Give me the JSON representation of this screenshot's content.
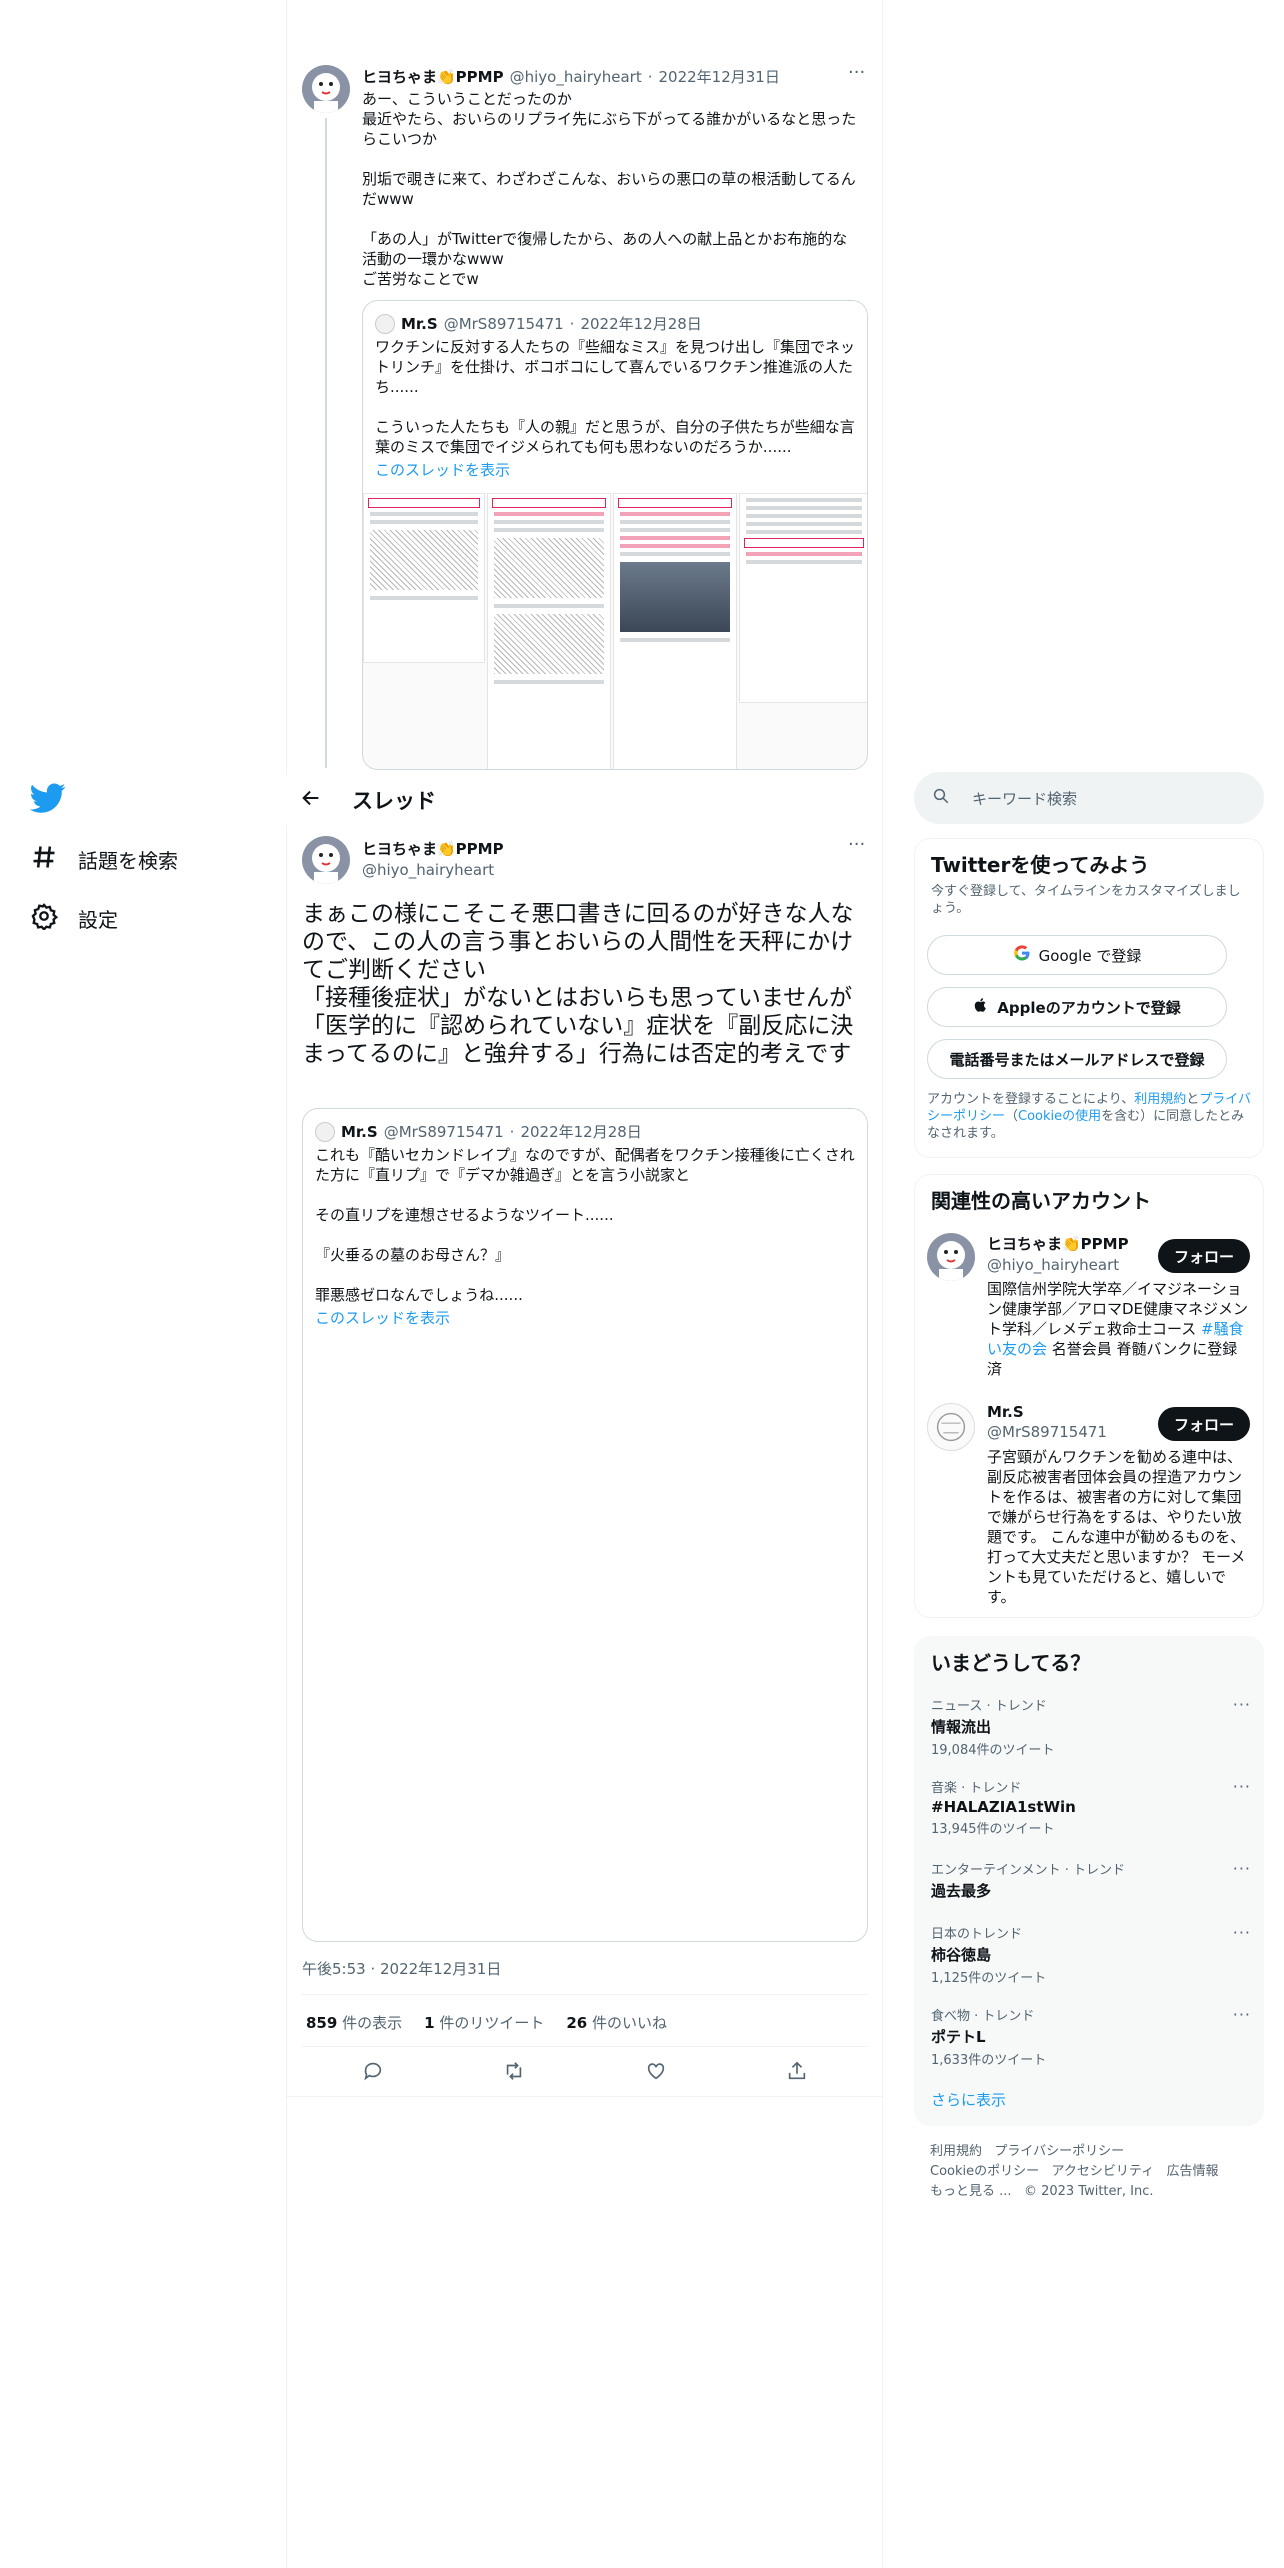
{
  "nav": {
    "explore_label": "話題を検索",
    "settings_label": "設定"
  },
  "prev_tweet": {
    "name": "ヒヨちゃま👏PPMP",
    "handle": "@hiyo_hairyheart",
    "date": "2022年12月31日",
    "more": "···",
    "text": "あー、こういうことだったのか\n最近やたら、おいらのリプライ先にぶら下がってる誰かがいるなと思ったらこいつか\n\n別垢で覗きに来て、わざわざこんな、おいらの悪口の草の根活動してるんだwww\n\n「あの人」がTwitterで復帰したから、あの人への献上品とかお布施的な活動の一環かなwww\nご苦労なことでw",
    "quote": {
      "name": "Mr.S",
      "handle": "@MrS89715471",
      "date": "2022年12月28日",
      "text": "ワクチンに反対する人たちの『些細なミス』を見つけ出し『集団でネットリンチ』を仕掛け、ボコボコにして喜んでいるワクチン推進派の人たち......\n\nこういった人たちも『人の親』だと思うが、自分の子供たちが些細な言葉のミスで集団でイジメられても何も思わないのだろうか......",
      "show_thread": "このスレッドを表示"
    }
  },
  "header": {
    "title": "スレッド"
  },
  "main_tweet": {
    "name": "ヒヨちゃま👏PPMP",
    "handle": "@hiyo_hairyheart",
    "more": "···",
    "text": "まぁこの様にこそこそ悪口書きに回るのが好きな人なので、この人の言う事とおいらの人間性を天秤にかけてご判断ください\n「接種後症状」がないとはおいらも思っていませんが「医学的に『認められていない』症状を『副反応に決まってるのに』と強弁する」行為には否定的考えです",
    "quote": {
      "name": "Mr.S",
      "handle": "@MrS89715471",
      "date": "2022年12月28日",
      "text": "これも『酷いセカンドレイプ』なのですが、配偶者をワクチン接種後に亡くされた方に『直リプ』で『デマか雑過ぎ』とを言う小説家と\n\nその直リプを連想させるようなツイート......\n\n『火垂るの墓のお母さん？』\n\n罪悪感ゼロなんでしょうね......",
      "show_thread": "このスレッドを表示"
    },
    "timestamp": "午後5:53 · 2022年12月31日",
    "stats": {
      "views_num": "859",
      "views_label": "件の表示",
      "retweets_num": "1",
      "retweets_label": "件のリツイート",
      "likes_num": "26",
      "likes_label": "件のいいね"
    }
  },
  "sidebar": {
    "search_placeholder": "キーワード検索",
    "signup": {
      "title": "Twitterを使ってみよう",
      "subtitle": "今すぐ登録して、タイムラインをカスタマイズしましょう。",
      "google": "Google で登録",
      "apple": "Appleのアカウントで登録",
      "phone": "電話番号またはメールアドレスで登録",
      "terms_1": "アカウントを登録することにより、",
      "terms_link1": "利用規約",
      "terms_2": "と",
      "terms_link2": "プライバシーポリシー",
      "terms_3": "（",
      "terms_link3": "Cookieの使用",
      "terms_4": "を含む）に同意したとみなされます。"
    },
    "related": {
      "title": "関連性の高いアカウント",
      "follow_label": "フォロー",
      "accounts": [
        {
          "name": "ヒヨちゃま👏PPMP",
          "handle": "@hiyo_hairyheart",
          "bio_1": "国際信州学院大学卒／イマジネーション健康学部／アロマDE健康マネジメント学科／レメデェ救命士コース ",
          "bio_link": "#騒食い友の会",
          "bio_2": " 名誉会員 脊髄バンクに登録済"
        },
        {
          "name": "Mr.S",
          "handle": "@MrS89715471",
          "bio": "子宮頸がんワクチンを勧める連中は、副反応被害者団体会員の捏造アカウントを作るは、被害者の方に対して集団で嫌がらせ行為をするは、やりたい放題です。 こんな連中が勧めるものを、打って大丈夫だと思いますか？ モーメントも見ていただけると、嬉しいです。"
        }
      ]
    },
    "trends": {
      "title": "いまどうしてる？",
      "items": [
        {
          "category": "ニュース · トレンド",
          "name": "情報流出",
          "count": "19,084件のツイート"
        },
        {
          "category": "音楽 · トレンド",
          "name": "#HALAZIA1stWin",
          "count": "13,945件のツイート"
        },
        {
          "category": "エンターテインメント · トレンド",
          "name": "過去最多",
          "count": ""
        },
        {
          "category": "日本のトレンド",
          "name": "柿谷徳島",
          "count": "1,125件のツイート"
        },
        {
          "category": "食べ物 · トレンド",
          "name": "ポテトL",
          "count": "1,633件のツイート"
        }
      ],
      "show_more": "さらに表示"
    },
    "footer": {
      "terms": "利用規約",
      "privacy": "プライバシーポリシー",
      "cookies": "Cookieのポリシー",
      "accessibility": "アクセシビリティ",
      "ads": "広告情報",
      "more": "もっと見る ...",
      "copyright": "© 2023 Twitter, Inc."
    }
  },
  "colors": {
    "accent": "#1d9bf0",
    "text": "#0f1419",
    "muted": "#536471",
    "border": "#eff3f4"
  }
}
